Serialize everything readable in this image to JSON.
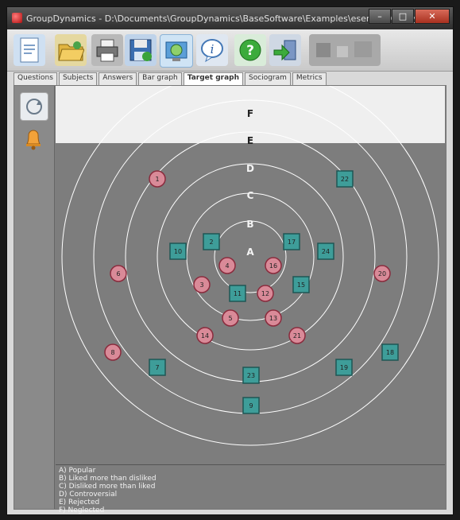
{
  "window": {
    "title": "GroupDynamics - D:\\Documents\\GroupDynamics\\BaseSoftware\\Examples\\esempio.GrpDyn",
    "buttons": {
      "minimize": "–",
      "maximize": "□",
      "close": "✕"
    }
  },
  "toolbar": {
    "buttons": [
      {
        "name": "new",
        "icon": "document-icon"
      },
      {
        "name": "open",
        "icon": "folder-open-icon"
      },
      {
        "name": "print",
        "icon": "printer-icon"
      },
      {
        "name": "save",
        "icon": "save-icon"
      },
      {
        "name": "globe",
        "icon": "globe-icon"
      },
      {
        "name": "info",
        "icon": "info-icon"
      },
      {
        "name": "help",
        "icon": "help-icon"
      },
      {
        "name": "exit",
        "icon": "exit-door-icon"
      },
      {
        "name": "extra",
        "icon": "toolbar-icon"
      }
    ]
  },
  "tabs": [
    "Questions",
    "Subjects",
    "Answers",
    "Bar graph",
    "Target graph",
    "Sociogram",
    "Metrics"
  ],
  "active_tab": "Target graph",
  "sidebar": {
    "buttons": [
      "refresh-icon",
      "bell-icon"
    ]
  },
  "target": {
    "ring_letters": [
      "A",
      "B",
      "C",
      "D",
      "E",
      "F"
    ],
    "nodes": [
      {
        "label": "1",
        "shape": "circle"
      },
      {
        "label": "22",
        "shape": "square"
      },
      {
        "label": "10",
        "shape": "square"
      },
      {
        "label": "2",
        "shape": "square"
      },
      {
        "label": "17",
        "shape": "square"
      },
      {
        "label": "24",
        "shape": "square"
      },
      {
        "label": "4",
        "shape": "circle"
      },
      {
        "label": "16",
        "shape": "circle"
      },
      {
        "label": "6",
        "shape": "circle"
      },
      {
        "label": "20",
        "shape": "circle"
      },
      {
        "label": "3",
        "shape": "circle"
      },
      {
        "label": "11",
        "shape": "square"
      },
      {
        "label": "12",
        "shape": "circle"
      },
      {
        "label": "15",
        "shape": "square"
      },
      {
        "label": "5",
        "shape": "circle"
      },
      {
        "label": "13",
        "shape": "circle"
      },
      {
        "label": "14",
        "shape": "circle"
      },
      {
        "label": "21",
        "shape": "circle"
      },
      {
        "label": "8",
        "shape": "circle"
      },
      {
        "label": "18",
        "shape": "square"
      },
      {
        "label": "7",
        "shape": "square"
      },
      {
        "label": "23",
        "shape": "square"
      },
      {
        "label": "19",
        "shape": "square"
      },
      {
        "label": "9",
        "shape": "square"
      }
    ]
  },
  "legend": [
    "A) Popular",
    "B) Liked more than disliked",
    "C) Disliked more than liked",
    "D) Controversial",
    "E) Rejected",
    "F) Neglected"
  ],
  "colors": {
    "node_circle_fill": "#d98a98",
    "node_circle_stroke": "#8a2b3d",
    "node_square_fill": "#3e9d99",
    "node_square_stroke": "#1e5655",
    "ring_stroke": "#ffffff",
    "chart_bg": "#7d7d7d"
  }
}
